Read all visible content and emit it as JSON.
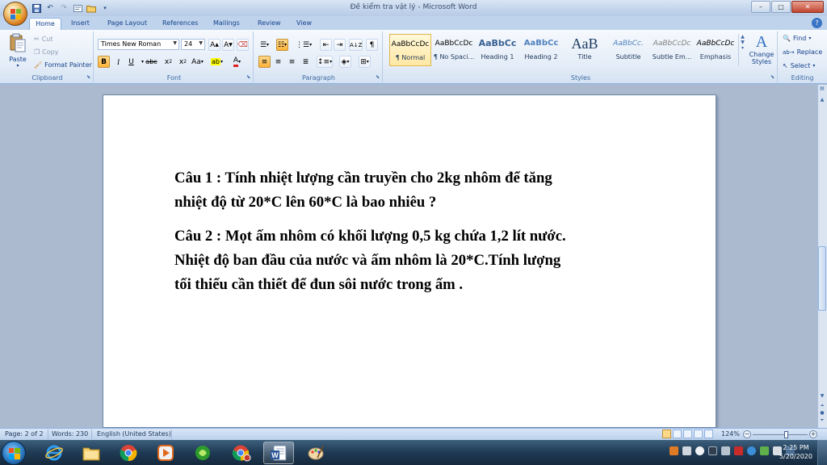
{
  "window": {
    "title": "Đề kiểm tra vật lý - Microsoft Word",
    "controls": {
      "minimize": "–",
      "maximize": "□",
      "close": "✕"
    }
  },
  "tabs": [
    "Home",
    "Insert",
    "Page Layout",
    "References",
    "Mailings",
    "Review",
    "View"
  ],
  "ribbon": {
    "clipboard": {
      "label": "Clipboard",
      "paste": "Paste",
      "cut": "Cut",
      "copy": "Copy",
      "format_painter": "Format Painter"
    },
    "font": {
      "label": "Font",
      "family": "Times New Roman",
      "size": "24"
    },
    "paragraph": {
      "label": "Paragraph"
    },
    "styles": {
      "label": "Styles",
      "items": [
        {
          "preview": "AaBbCcDc",
          "name": "¶ Normal"
        },
        {
          "preview": "AaBbCcDc",
          "name": "¶ No Spaci..."
        },
        {
          "preview": "AaBbCc",
          "name": "Heading 1"
        },
        {
          "preview": "AaBbCc",
          "name": "Heading 2"
        },
        {
          "preview": "AaB",
          "name": "Title"
        },
        {
          "preview": "AaBbCc.",
          "name": "Subtitle"
        },
        {
          "preview": "AaBbCcDc",
          "name": "Subtle Em..."
        },
        {
          "preview": "AaBbCcDc",
          "name": "Emphasis"
        }
      ],
      "change_styles": "Change Styles"
    },
    "editing": {
      "label": "Editing",
      "find": "Find",
      "replace": "Replace",
      "select": "Select"
    }
  },
  "document": {
    "q1_line1": "Câu 1 : Tính nhiệt lượng cần truyền cho 2kg nhôm để tăng",
    "q1_line2": "nhiệt độ từ 20*C lên 60*C là bao nhiêu ?",
    "q2_line1": "Câu 2 : Mọt ấm nhôm có khối lượng 0,5 kg chứa 1,2 lít nước.",
    "q2_line2": "Nhiệt độ ban đầu của nước và ấm nhôm là 20*C.Tính lượng",
    "q2_line3": "tối thiểu cần thiết để đun sôi nước trong ấm ."
  },
  "status": {
    "page": "Page: 2 of 2",
    "words": "Words: 230",
    "language": "English (United States)",
    "zoom": "124%"
  },
  "taskbar": {
    "time": "2:25 PM",
    "date": "5/20/2020"
  }
}
